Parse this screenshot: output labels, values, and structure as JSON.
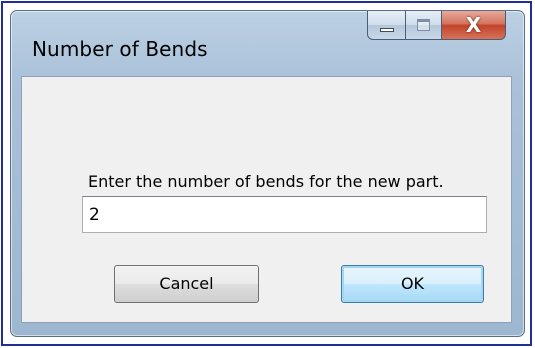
{
  "dialog": {
    "title": "Number of Bends",
    "prompt": "Enter the number of bends for the new part.",
    "input_value": "2",
    "cancel_label": "Cancel",
    "ok_label": "OK"
  },
  "caption_buttons": {
    "minimize_icon": "minimize-icon",
    "maximize_icon": "maximize-icon",
    "close_icon": "close-icon",
    "close_glyph": "X"
  },
  "colors": {
    "frame_border": "#1f2f96",
    "window_chrome": "#a9c1d9",
    "client_background": "#f0f0f0",
    "close_button": "#c2442a",
    "ok_focus": "#3c7fb1"
  }
}
